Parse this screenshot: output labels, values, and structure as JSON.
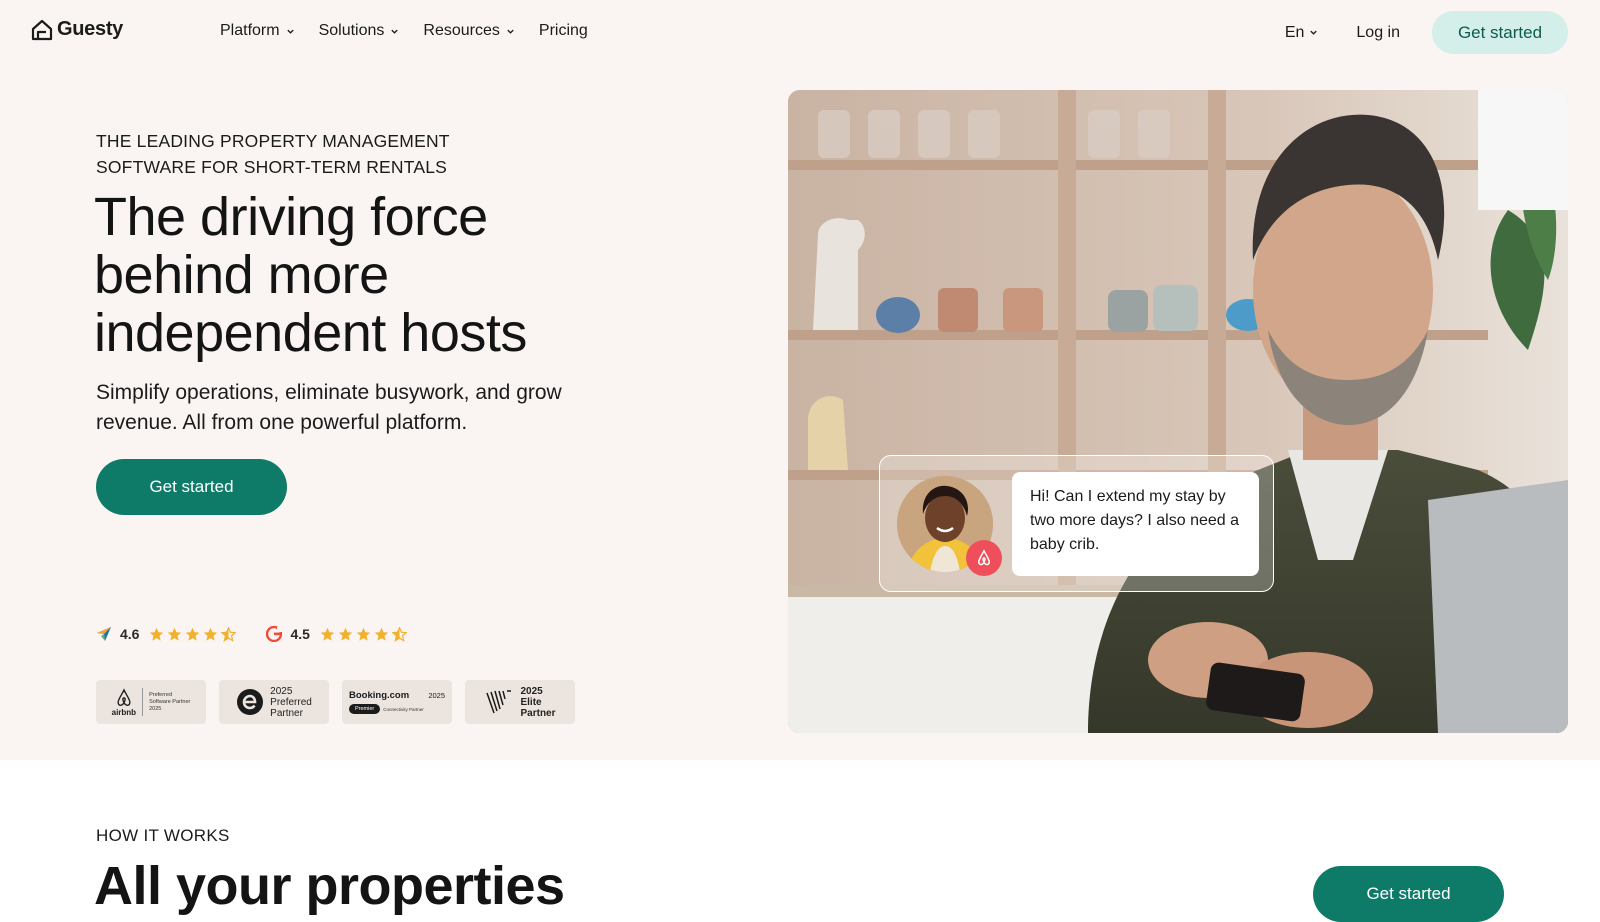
{
  "brand": {
    "name": "Guesty",
    "accent": "#0e7a68",
    "accent_light": "#d4eeea",
    "hero_bg": "#faf5f2"
  },
  "nav": {
    "items": [
      {
        "label": "Platform",
        "has_dropdown": true
      },
      {
        "label": "Solutions",
        "has_dropdown": true
      },
      {
        "label": "Resources",
        "has_dropdown": true
      },
      {
        "label": "Pricing",
        "has_dropdown": false
      }
    ],
    "language": "En",
    "login": "Log in",
    "cta": "Get started"
  },
  "hero": {
    "eyebrow": "THE LEADING PROPERTY MANAGEMENT SOFTWARE FOR SHORT-TERM RENTALS",
    "headline": "The driving force behind more independent hosts",
    "subtitle": "Simplify operations, eliminate busywork, and grow revenue. All from one powerful platform.",
    "cta": "Get started",
    "ratings": [
      {
        "icon": "capterra-icon",
        "value": "4.6",
        "stars": 4.5
      },
      {
        "icon": "g2-icon",
        "value": "4.5",
        "stars": 4.5
      }
    ],
    "badges": [
      {
        "name": "airbnb",
        "lines": [
          "Preferred",
          "Software Partner",
          "2025"
        ],
        "brand": "airbnb"
      },
      {
        "name": "expedia",
        "lines": [
          "2025",
          "Preferred",
          "Partner"
        ]
      },
      {
        "name": "booking",
        "brand": "Booking.com",
        "year": "2025",
        "tag": "Premier",
        "sub": "Connectivity Partner"
      },
      {
        "name": "vrbo",
        "lines": [
          "2025",
          "Elite",
          "Partner"
        ]
      }
    ],
    "chat": {
      "message": "Hi! Can I extend my stay by two more days? I also need a baby crib."
    }
  },
  "how": {
    "label": "HOW IT WORKS",
    "title": "All your properties",
    "cta": "Get started"
  }
}
